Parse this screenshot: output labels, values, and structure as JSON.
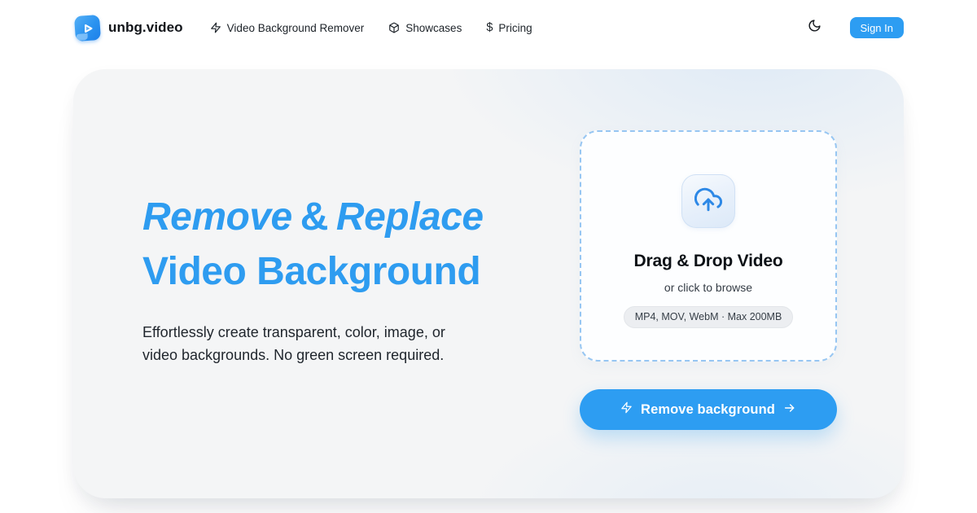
{
  "brand": {
    "name": "unbg.video"
  },
  "nav": {
    "items": [
      {
        "label": "Video Background Remover",
        "icon": "zap-icon"
      },
      {
        "label": "Showcases",
        "icon": "box-icon"
      },
      {
        "label": "Pricing",
        "icon": "dollar-icon"
      }
    ],
    "dollar_glyph": "$",
    "theme_toggle": "moon-icon",
    "sign_in_label": "Sign In"
  },
  "hero": {
    "headline": {
      "italic1": "Remove",
      "amp": "&",
      "italic2": "Replace",
      "line2": "Video Background"
    },
    "description": "Effortlessly create transparent, color, image, or video backgrounds. No green screen required.",
    "accent_color": "#2d9df2",
    "headline_color": "#2e9cf0",
    "card_background": "#f4f5f6"
  },
  "uploader": {
    "title": "Drag & Drop Video",
    "subtitle": "or click to browse",
    "badge": "MP4, MOV, WebM · Max 200MB",
    "icon": "cloud-upload-icon"
  },
  "cta": {
    "label": "Remove background",
    "left_icon": "zap-icon",
    "right_icon": "arrow-right-icon"
  }
}
